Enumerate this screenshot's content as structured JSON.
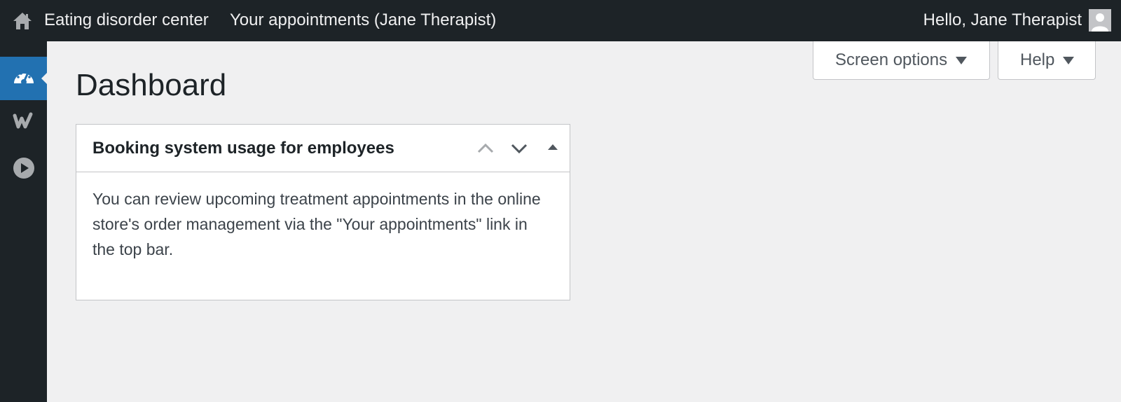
{
  "topbar": {
    "site_name": "Eating disorder center",
    "appointments_link": "Your appointments (Jane Therapist)",
    "greeting": "Hello, Jane Therapist",
    "home_icon": "home-icon",
    "avatar_icon": "user-avatar-icon"
  },
  "sidebar": {
    "items": [
      {
        "icon": "dashboard-gauge-icon",
        "active": true
      },
      {
        "icon": "woocommerce-w-icon",
        "active": false
      },
      {
        "icon": "play-circle-icon",
        "active": false
      }
    ]
  },
  "screen_meta": {
    "screen_options_label": "Screen options",
    "help_label": "Help"
  },
  "page": {
    "title": "Dashboard"
  },
  "widget": {
    "title": "Booking system usage for employees",
    "body": "You can review upcoming treatment appointments in the online store's order management via the \"Your appointments\" link in the top bar."
  },
  "colors": {
    "admin_bar": "#1d2327",
    "accent": "#2271b1",
    "background": "#f0f0f1"
  }
}
